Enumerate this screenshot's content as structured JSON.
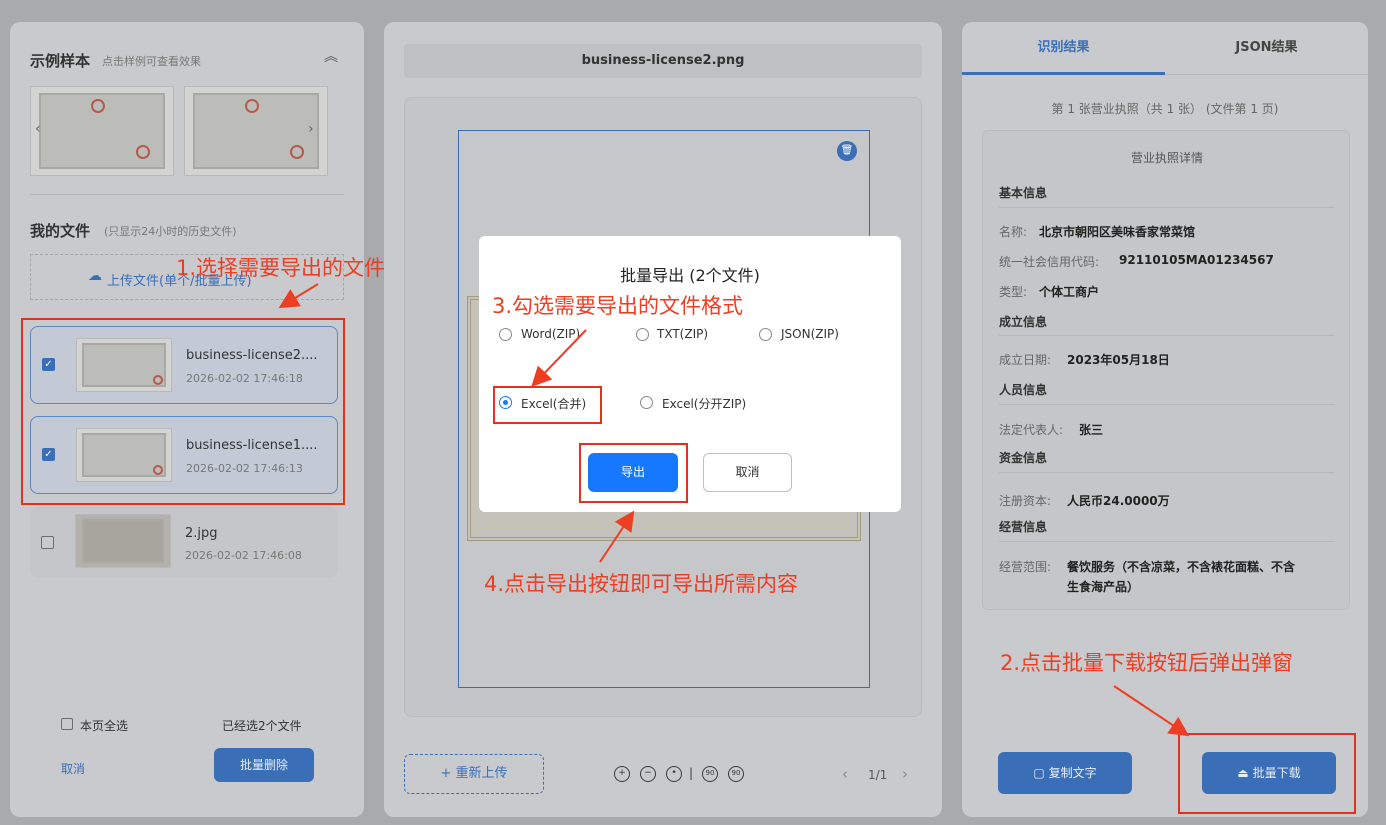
{
  "left": {
    "sample_title": "示例样本",
    "sample_hint": "点击样例可查看效果",
    "my_files_title": "我的文件",
    "my_files_hint": "(只显示24小时的历史文件)",
    "upload_label": "上传文件(单个/批量上传)",
    "files": [
      {
        "name": "business-license2....",
        "time": "2026-02-02 17:46:18",
        "checked": true
      },
      {
        "name": "business-license1....",
        "time": "2026-02-02 17:46:13",
        "checked": true
      },
      {
        "name": "2.jpg",
        "time": "2026-02-02 17:46:08",
        "checked": false
      }
    ],
    "select_all": "本页全选",
    "selected_count": "已经选2个文件",
    "cancel": "取消",
    "batch_delete": "批量删除"
  },
  "center": {
    "file_title": "business-license2.png",
    "reupload": "+ 重新上传",
    "page": "1/1"
  },
  "right": {
    "tab_result": "识别结果",
    "tab_json": "JSON结果",
    "summary": "第 1 张营业执照（共 1 张） (文件第 1 页)",
    "card_title": "营业执照详情",
    "sections": {
      "basic": "基本信息",
      "establish": "成立信息",
      "person": "人员信息",
      "capital": "资金信息",
      "business": "经营信息"
    },
    "fields": {
      "name_label": "名称:",
      "name_value": "北京市朝阳区美味香家常菜馆",
      "code_label": "统一社会信用代码:",
      "code_value": "92110105MA01234567",
      "type_label": "类型:",
      "type_value": "个体工商户",
      "date_label": "成立日期:",
      "date_value": "2023年05月18日",
      "rep_label": "法定代表人:",
      "rep_value": "张三",
      "capital_label": "注册资本:",
      "capital_value": "人民币24.0000万",
      "scope_label": "经营范围:",
      "scope_value_1": "餐饮服务（不含凉菜，不含裱花面糕、不含",
      "scope_value_2": "生食海产品）"
    },
    "copy_text": "复制文字",
    "batch_download": "批量下载"
  },
  "modal": {
    "title": "批量导出 (2个文件)",
    "options": [
      {
        "label": "Word(ZIP)",
        "selected": false
      },
      {
        "label": "TXT(ZIP)",
        "selected": false
      },
      {
        "label": "JSON(ZIP)",
        "selected": false
      },
      {
        "label": "Excel(合并)",
        "selected": true
      },
      {
        "label": "Excel(分开ZIP)",
        "selected": false
      }
    ],
    "export": "导出",
    "cancel": "取消"
  },
  "annotations": {
    "a1": "1.选择需要导出的文件",
    "a2": "2.点击批量下载按钮后弹出弹窗",
    "a3": "3.勾选需要导出的文件格式",
    "a4": "4.点击导出按钮即可导出所需内容"
  },
  "colors": {
    "overlay_bg": "#a9aaad",
    "primary": "#1677ff",
    "annotation": "#ec3e22"
  }
}
